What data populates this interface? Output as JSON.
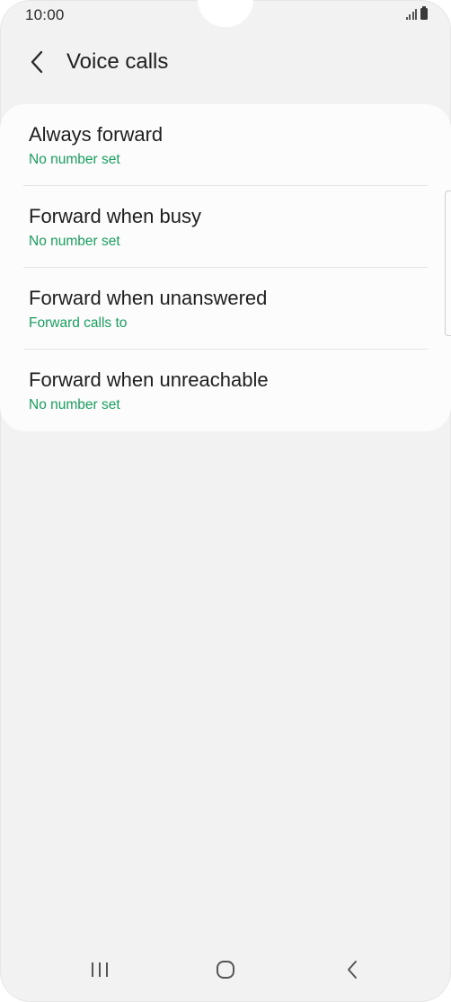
{
  "status_bar": {
    "time": "10:00",
    "icons": [
      "signal-icon",
      "battery-icon"
    ]
  },
  "header": {
    "back_icon": "chevron-left-icon",
    "title": "Voice calls"
  },
  "options": [
    {
      "title": "Always forward",
      "subtitle": "No number set"
    },
    {
      "title": "Forward when busy",
      "subtitle": "No number set"
    },
    {
      "title": "Forward when unanswered",
      "subtitle": "Forward calls to"
    },
    {
      "title": "Forward when unreachable",
      "subtitle": "No number set"
    }
  ],
  "nav_bar": {
    "recents_icon": "recent-apps-icon",
    "home_icon": "home-icon",
    "back_icon": "back-icon"
  },
  "colors": {
    "background": "#f2f2f2",
    "card": "#fcfcfc",
    "accent_text": "#1a9f5e",
    "primary_text": "#1e1e1e"
  }
}
